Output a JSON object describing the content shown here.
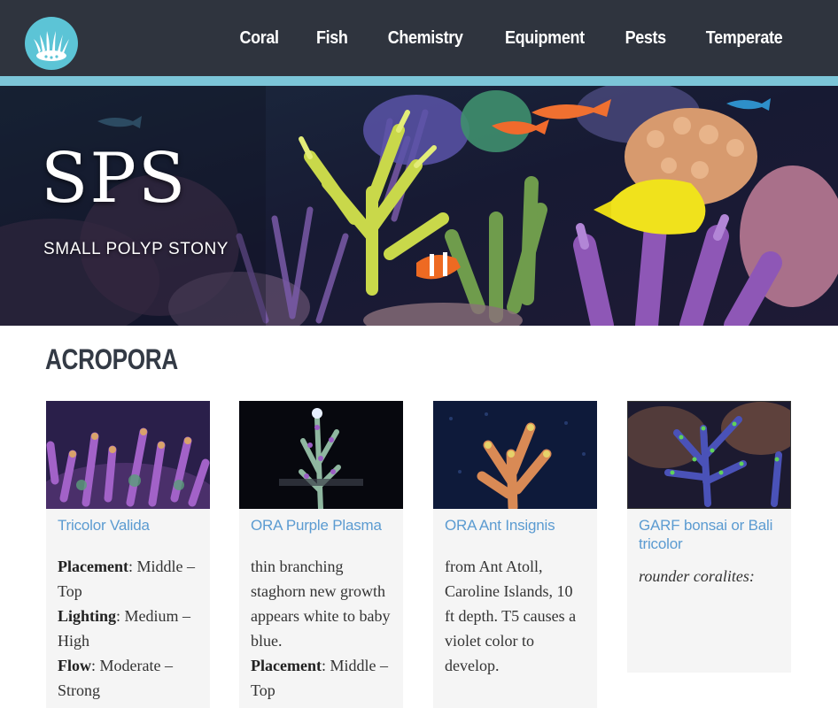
{
  "nav": {
    "items": [
      "Coral",
      "Fish",
      "Chemistry",
      "Equipment",
      "Pests",
      "Temperate"
    ]
  },
  "hero": {
    "title": "SPS",
    "subtitle": "SMALL POLYP STONY"
  },
  "section": {
    "title": "ACROPORA"
  },
  "cards": [
    {
      "name": "Tricolor Valida",
      "placement_label": "Placement",
      "placement_value": "Middle – Top",
      "lighting_label": "Lighting",
      "lighting_value": "Medium – High",
      "flow_label": "Flow",
      "flow_value": "Moderate – Strong"
    },
    {
      "name": "ORA Purple Plasma",
      "description": "thin branching staghorn new growth appears white to baby blue.",
      "placement_label": "Placement",
      "placement_value": "Middle – Top"
    },
    {
      "name": "ORA Ant Insignis",
      "description": "from Ant Atoll, Caroline Islands, 10 ft depth. T5 causes a violet color to develop."
    },
    {
      "name": "GARF bonsai or Bali tricolor",
      "description": "rounder coralites:"
    }
  ],
  "colors": {
    "header_bg": "#2f343e",
    "accent": "#7cc5d8",
    "link": "#5b9bd1",
    "card_bg": "#f5f5f5"
  }
}
